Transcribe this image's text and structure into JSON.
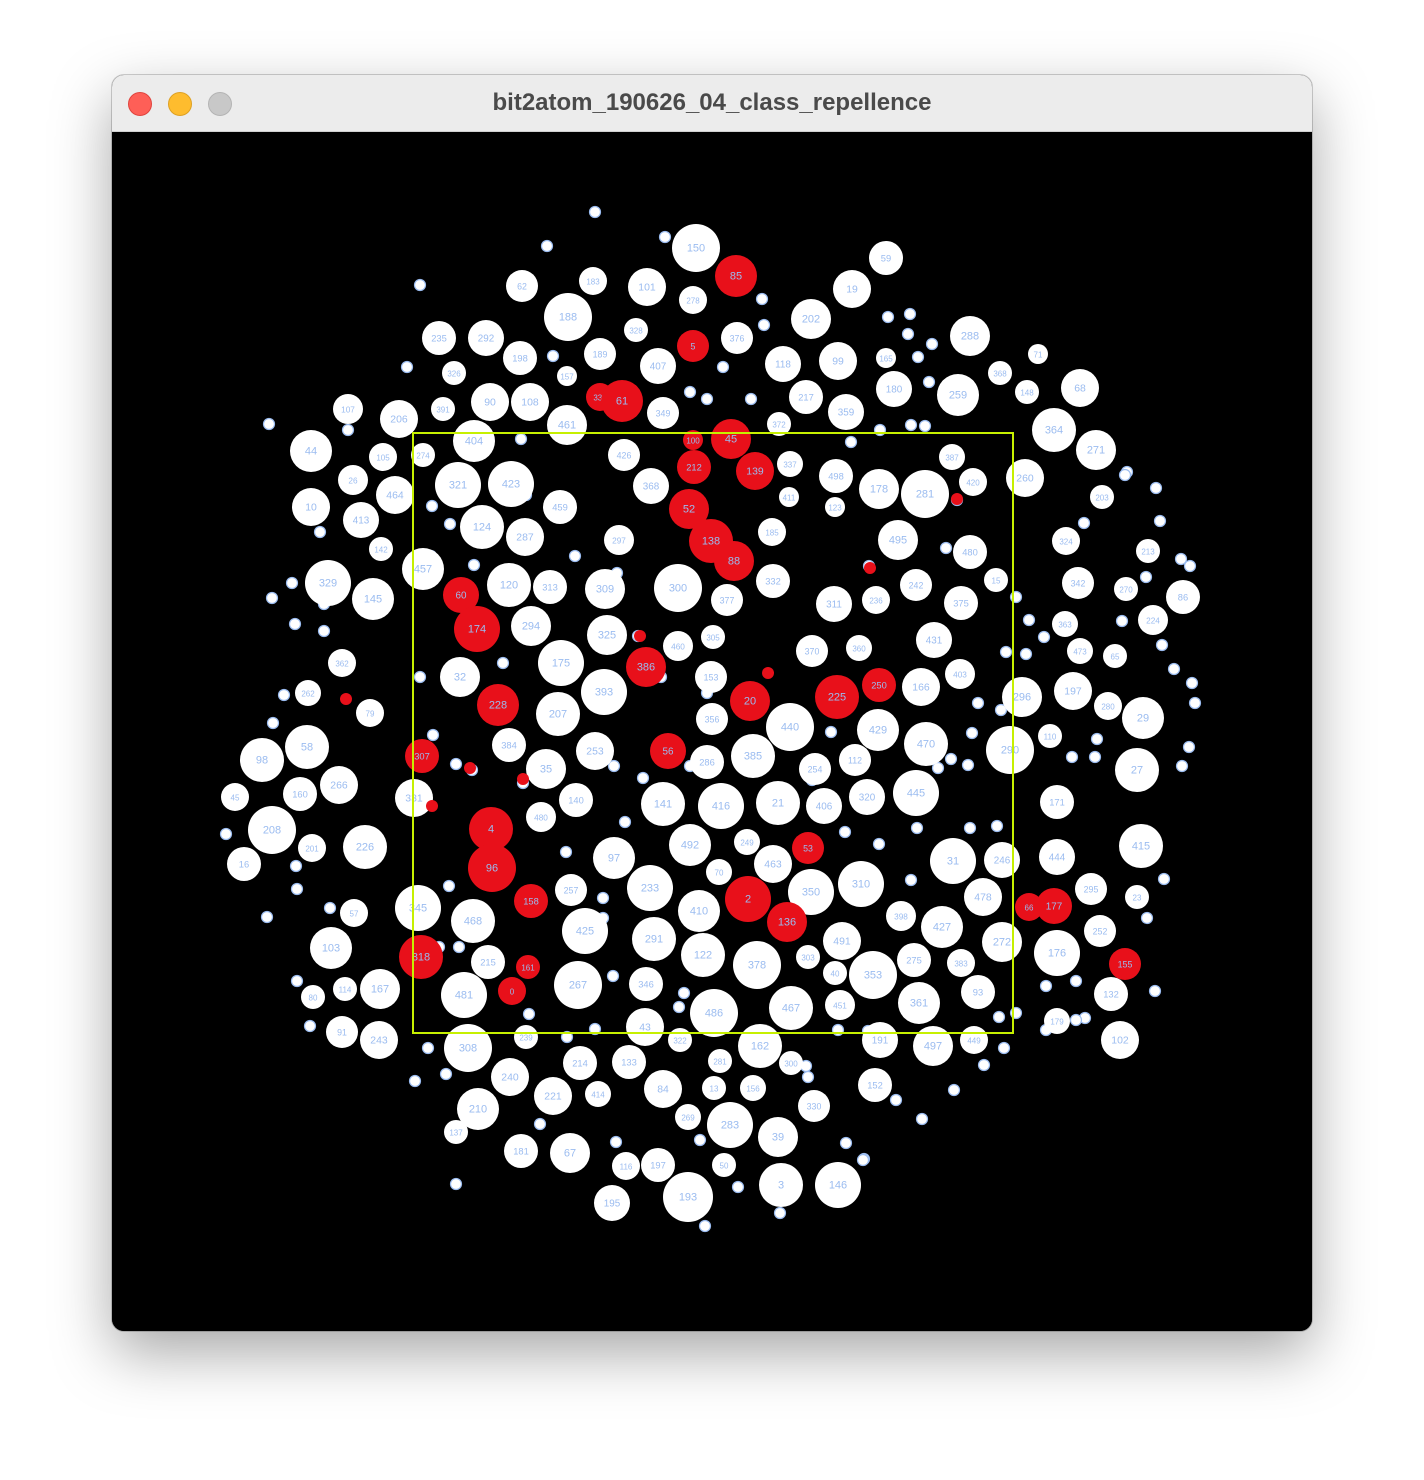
{
  "window": {
    "title": "bit2atom_190626_04_class_repellence"
  },
  "colors": {
    "background": "#000000",
    "atom_white": "#ffffff",
    "atom_red": "#e8101a",
    "label": "#9bbcf0",
    "frame": "#c6f000",
    "titlebar": "#ececec"
  },
  "frame_label": "boundary-frame",
  "atoms": [
    {
      "label": "150",
      "c": "w"
    },
    {
      "label": "59",
      "c": "w"
    },
    {
      "label": "85",
      "c": "r"
    },
    {
      "label": "62",
      "c": "w"
    },
    {
      "label": "183",
      "c": "w"
    },
    {
      "label": "101",
      "c": "w"
    },
    {
      "label": "19",
      "c": "w"
    },
    {
      "label": "278",
      "c": "w"
    },
    {
      "label": "188",
      "c": "w"
    },
    {
      "label": "202",
      "c": "w"
    },
    {
      "label": "235",
      "c": "w"
    },
    {
      "label": "292",
      "c": "w"
    },
    {
      "label": "328",
      "c": "w"
    },
    {
      "label": "376",
      "c": "w"
    },
    {
      "label": "288",
      "c": "w"
    },
    {
      "label": "5",
      "c": "r"
    },
    {
      "label": "198",
      "c": "w"
    },
    {
      "label": "189",
      "c": "w"
    },
    {
      "label": "407",
      "c": "w"
    },
    {
      "label": "118",
      "c": "w"
    },
    {
      "label": "99",
      "c": "w"
    },
    {
      "label": "165",
      "c": "w"
    },
    {
      "label": "71",
      "c": "w"
    },
    {
      "label": "326",
      "c": "w"
    },
    {
      "label": "157",
      "c": "w"
    },
    {
      "label": "180",
      "c": "w"
    },
    {
      "label": "368",
      "c": "w"
    },
    {
      "label": "90",
      "c": "w"
    },
    {
      "label": "108",
      "c": "w"
    },
    {
      "label": "336",
      "c": "r"
    },
    {
      "label": "61",
      "c": "r"
    },
    {
      "label": "217",
      "c": "w"
    },
    {
      "label": "259",
      "c": "w"
    },
    {
      "label": "148",
      "c": "w"
    },
    {
      "label": "68",
      "c": "w"
    },
    {
      "label": "107",
      "c": "w"
    },
    {
      "label": "206",
      "c": "w"
    },
    {
      "label": "391",
      "c": "w"
    },
    {
      "label": "461",
      "c": "w"
    },
    {
      "label": "349",
      "c": "w"
    },
    {
      "label": "372",
      "c": "w"
    },
    {
      "label": "359",
      "c": "w"
    },
    {
      "label": "45",
      "c": "r"
    },
    {
      "label": "364",
      "c": "w"
    },
    {
      "label": "44",
      "c": "w"
    },
    {
      "label": "404",
      "c": "w"
    },
    {
      "label": "100",
      "c": "r"
    },
    {
      "label": "271",
      "c": "w"
    },
    {
      "label": "105",
      "c": "w"
    },
    {
      "label": "274",
      "c": "w"
    },
    {
      "label": "426",
      "c": "w"
    },
    {
      "label": "212",
      "c": "r"
    },
    {
      "label": "139",
      "c": "r"
    },
    {
      "label": "337",
      "c": "w"
    },
    {
      "label": "387",
      "c": "w"
    },
    {
      "label": "26",
      "c": "w"
    },
    {
      "label": "321",
      "c": "w"
    },
    {
      "label": "423",
      "c": "w"
    },
    {
      "label": "368",
      "c": "w"
    },
    {
      "label": "498",
      "c": "w"
    },
    {
      "label": "178",
      "c": "w"
    },
    {
      "label": "281",
      "c": "w"
    },
    {
      "label": "420",
      "c": "w"
    },
    {
      "label": "260",
      "c": "w"
    },
    {
      "label": "464",
      "c": "w"
    },
    {
      "label": "10",
      "c": "w"
    },
    {
      "label": "52",
      "c": "r"
    },
    {
      "label": "411",
      "c": "w"
    },
    {
      "label": "123",
      "c": "w"
    },
    {
      "label": "459",
      "c": "w"
    },
    {
      "label": "203",
      "c": "w"
    },
    {
      "label": "413",
      "c": "w"
    },
    {
      "label": "124",
      "c": "w"
    },
    {
      "label": "287",
      "c": "w"
    },
    {
      "label": "138",
      "c": "r"
    },
    {
      "label": "88",
      "c": "r"
    },
    {
      "label": "185",
      "c": "w"
    },
    {
      "label": "495",
      "c": "w"
    },
    {
      "label": "480",
      "c": "w"
    },
    {
      "label": "324",
      "c": "w"
    },
    {
      "label": "213",
      "c": "w"
    },
    {
      "label": "142",
      "c": "w"
    },
    {
      "label": "297",
      "c": "w"
    },
    {
      "label": "457",
      "c": "w"
    },
    {
      "label": "120",
      "c": "w"
    },
    {
      "label": "313",
      "c": "w"
    },
    {
      "label": "309",
      "c": "w"
    },
    {
      "label": "300",
      "c": "w"
    },
    {
      "label": "60",
      "c": "r"
    },
    {
      "label": "329",
      "c": "w"
    },
    {
      "label": "145",
      "c": "w"
    },
    {
      "label": "332",
      "c": "w"
    },
    {
      "label": "377",
      "c": "w"
    },
    {
      "label": "311",
      "c": "w"
    },
    {
      "label": "236",
      "c": "w"
    },
    {
      "label": "242",
      "c": "w"
    },
    {
      "label": "375",
      "c": "w"
    },
    {
      "label": "15",
      "c": "w"
    },
    {
      "label": "342",
      "c": "w"
    },
    {
      "label": "270",
      "c": "w"
    },
    {
      "label": "86",
      "c": "w"
    },
    {
      "label": "174",
      "c": "r"
    },
    {
      "label": "294",
      "c": "w"
    },
    {
      "label": "325",
      "c": "w"
    },
    {
      "label": "363",
      "c": "w"
    },
    {
      "label": "224",
      "c": "w"
    },
    {
      "label": "431",
      "c": "w"
    },
    {
      "label": "175",
      "c": "w"
    },
    {
      "label": "386",
      "c": "r"
    },
    {
      "label": "460",
      "c": "w"
    },
    {
      "label": "305",
      "c": "w"
    },
    {
      "label": "370",
      "c": "w"
    },
    {
      "label": "360",
      "c": "w"
    },
    {
      "label": "473",
      "c": "w"
    },
    {
      "label": "65",
      "c": "w"
    },
    {
      "label": "362",
      "c": "w"
    },
    {
      "label": "32",
      "c": "w"
    },
    {
      "label": "393",
      "c": "w"
    },
    {
      "label": "153",
      "c": "w"
    },
    {
      "label": "20",
      "c": "r"
    },
    {
      "label": "225",
      "c": "r"
    },
    {
      "label": "250",
      "c": "r"
    },
    {
      "label": "166",
      "c": "w"
    },
    {
      "label": "403",
      "c": "w"
    },
    {
      "label": "296",
      "c": "w"
    },
    {
      "label": "197",
      "c": "w"
    },
    {
      "label": "280",
      "c": "w"
    },
    {
      "label": "262",
      "c": "w"
    },
    {
      "label": "228",
      "c": "r"
    },
    {
      "label": "207",
      "c": "w"
    },
    {
      "label": "356",
      "c": "w"
    },
    {
      "label": "440",
      "c": "w"
    },
    {
      "label": "429",
      "c": "w"
    },
    {
      "label": "29",
      "c": "w"
    },
    {
      "label": "79",
      "c": "w"
    },
    {
      "label": "58",
      "c": "w"
    },
    {
      "label": "98",
      "c": "w"
    },
    {
      "label": "384",
      "c": "w"
    },
    {
      "label": "253",
      "c": "w"
    },
    {
      "label": "56",
      "c": "r"
    },
    {
      "label": "385",
      "c": "w"
    },
    {
      "label": "470",
      "c": "w"
    },
    {
      "label": "290",
      "c": "w"
    },
    {
      "label": "110",
      "c": "w"
    },
    {
      "label": "27",
      "c": "w"
    },
    {
      "label": "307",
      "c": "r"
    },
    {
      "label": "35",
      "c": "w"
    },
    {
      "label": "286",
      "c": "w"
    },
    {
      "label": "254",
      "c": "w"
    },
    {
      "label": "112",
      "c": "w"
    },
    {
      "label": "160",
      "c": "w"
    },
    {
      "label": "266",
      "c": "w"
    },
    {
      "label": "331",
      "c": "w"
    },
    {
      "label": "140",
      "c": "w"
    },
    {
      "label": "141",
      "c": "w"
    },
    {
      "label": "416",
      "c": "w"
    },
    {
      "label": "21",
      "c": "w"
    },
    {
      "label": "406",
      "c": "w"
    },
    {
      "label": "320",
      "c": "w"
    },
    {
      "label": "445",
      "c": "w"
    },
    {
      "label": "171",
      "c": "w"
    },
    {
      "label": "45",
      "c": "w"
    },
    {
      "label": "208",
      "c": "w"
    },
    {
      "label": "4",
      "c": "r"
    },
    {
      "label": "480",
      "c": "w"
    },
    {
      "label": "492",
      "c": "w"
    },
    {
      "label": "53",
      "c": "r"
    },
    {
      "label": "415",
      "c": "w"
    },
    {
      "label": "201",
      "c": "w"
    },
    {
      "label": "226",
      "c": "w"
    },
    {
      "label": "97",
      "c": "w"
    },
    {
      "label": "463",
      "c": "w"
    },
    {
      "label": "31",
      "c": "w"
    },
    {
      "label": "246",
      "c": "w"
    },
    {
      "label": "444",
      "c": "w"
    },
    {
      "label": "16",
      "c": "w"
    },
    {
      "label": "96",
      "c": "r"
    },
    {
      "label": "70",
      "c": "w"
    },
    {
      "label": "233",
      "c": "w"
    },
    {
      "label": "2",
      "c": "r"
    },
    {
      "label": "350",
      "c": "w"
    },
    {
      "label": "310",
      "c": "w"
    },
    {
      "label": "478",
      "c": "w"
    },
    {
      "label": "66",
      "c": "r"
    },
    {
      "label": "177",
      "c": "r"
    },
    {
      "label": "295",
      "c": "w"
    },
    {
      "label": "257",
      "c": "w"
    },
    {
      "label": "345",
      "c": "w"
    },
    {
      "label": "158",
      "c": "r"
    },
    {
      "label": "468",
      "c": "w"
    },
    {
      "label": "410",
      "c": "w"
    },
    {
      "label": "136",
      "c": "r"
    },
    {
      "label": "398",
      "c": "w"
    },
    {
      "label": "427",
      "c": "w"
    },
    {
      "label": "23",
      "c": "w"
    },
    {
      "label": "57",
      "c": "w"
    },
    {
      "label": "425",
      "c": "w"
    },
    {
      "label": "291",
      "c": "w"
    },
    {
      "label": "491",
      "c": "w"
    },
    {
      "label": "272",
      "c": "w"
    },
    {
      "label": "252",
      "c": "w"
    },
    {
      "label": "103",
      "c": "w"
    },
    {
      "label": "318",
      "c": "r"
    },
    {
      "label": "215",
      "c": "w"
    },
    {
      "label": "122",
      "c": "w"
    },
    {
      "label": "378",
      "c": "w"
    },
    {
      "label": "275",
      "c": "w"
    },
    {
      "label": "176",
      "c": "w"
    },
    {
      "label": "155",
      "c": "r"
    },
    {
      "label": "161",
      "c": "r"
    },
    {
      "label": "353",
      "c": "w"
    },
    {
      "label": "167",
      "c": "w"
    },
    {
      "label": "481",
      "c": "w"
    },
    {
      "label": "0",
      "c": "r"
    },
    {
      "label": "267",
      "c": "w"
    },
    {
      "label": "346",
      "c": "w"
    },
    {
      "label": "486",
      "c": "w"
    },
    {
      "label": "467",
      "c": "w"
    },
    {
      "label": "451",
      "c": "w"
    },
    {
      "label": "361",
      "c": "w"
    },
    {
      "label": "93",
      "c": "w"
    },
    {
      "label": "132",
      "c": "w"
    },
    {
      "label": "91",
      "c": "w"
    },
    {
      "label": "243",
      "c": "w"
    },
    {
      "label": "43",
      "c": "w"
    },
    {
      "label": "191",
      "c": "w"
    },
    {
      "label": "102",
      "c": "w"
    },
    {
      "label": "308",
      "c": "w"
    },
    {
      "label": "162",
      "c": "w"
    },
    {
      "label": "497",
      "c": "w"
    },
    {
      "label": "449",
      "c": "w"
    },
    {
      "label": "214",
      "c": "w"
    },
    {
      "label": "133",
      "c": "w"
    },
    {
      "label": "240",
      "c": "w"
    },
    {
      "label": "84",
      "c": "w"
    },
    {
      "label": "221",
      "c": "w"
    },
    {
      "label": "210",
      "c": "w"
    },
    {
      "label": "283",
      "c": "w"
    },
    {
      "label": "330",
      "c": "w"
    },
    {
      "label": "39",
      "c": "w"
    },
    {
      "label": "181",
      "c": "w"
    },
    {
      "label": "67",
      "c": "w"
    },
    {
      "label": "197",
      "c": "w"
    },
    {
      "label": "193",
      "c": "w"
    },
    {
      "label": "3",
      "c": "w"
    },
    {
      "label": "146",
      "c": "w"
    },
    {
      "label": "195",
      "c": "w"
    },
    {
      "label": "179",
      "c": "w"
    },
    {
      "label": "414",
      "c": "w"
    },
    {
      "label": "269",
      "c": "w"
    },
    {
      "label": "152",
      "c": "w"
    },
    {
      "label": "156",
      "c": "w"
    },
    {
      "label": "50",
      "c": "w"
    },
    {
      "label": "116",
      "c": "w"
    },
    {
      "label": "13",
      "c": "w"
    },
    {
      "label": "322",
      "c": "w"
    },
    {
      "label": "281",
      "c": "w"
    },
    {
      "label": "300",
      "c": "w"
    },
    {
      "label": "114",
      "c": "w"
    },
    {
      "label": "239",
      "c": "w"
    },
    {
      "label": "137",
      "c": "w"
    },
    {
      "label": "80",
      "c": "w"
    },
    {
      "label": "249",
      "c": "w"
    },
    {
      "label": "40",
      "c": "w"
    },
    {
      "label": "303",
      "c": "w"
    },
    {
      "label": "383",
      "c": "w"
    }
  ]
}
